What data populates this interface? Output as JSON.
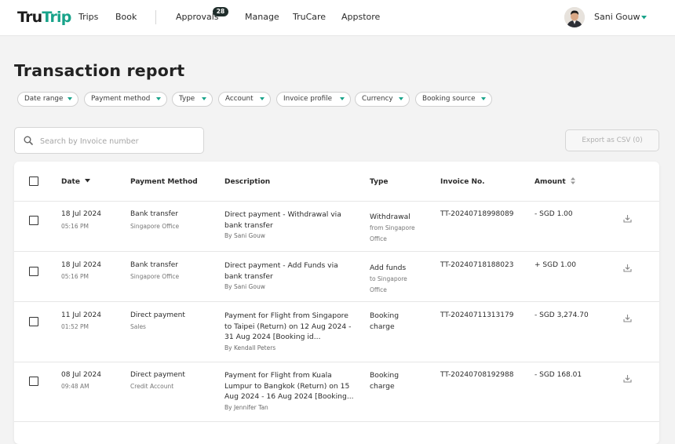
{
  "brand": {
    "part1": "Tru",
    "part2": "Trip"
  },
  "nav": {
    "trips": "Trips",
    "book": "Book",
    "approvals": "Approvals",
    "approvals_badge": "28",
    "manage": "Manage",
    "trucare": "TruCare",
    "appstore": "Appstore"
  },
  "user": {
    "name": "Sani Gouw"
  },
  "page": {
    "title": "Transaction report"
  },
  "filters": [
    "Date range",
    "Payment method",
    "Type",
    "Account",
    "Invoice profile",
    "Currency",
    "Booking source"
  ],
  "search": {
    "placeholder": "Search by Invoice number"
  },
  "export": {
    "label": "Export as CSV (0)"
  },
  "table": {
    "headers": {
      "date": "Date",
      "payment_method": "Payment Method",
      "description": "Description",
      "type": "Type",
      "invoice": "Invoice No.",
      "amount": "Amount"
    },
    "rows": [
      {
        "date": "18 Jul 2024",
        "time": "05:16 PM",
        "method": "Bank transfer",
        "account": "Singapore Office",
        "desc1": "Direct payment - Withdrawal via",
        "desc2": "bank transfer",
        "desc3": "",
        "by": "By Sani Gouw",
        "type": "Withdrawal",
        "type2": "",
        "type_sub1": "from Singapore",
        "type_sub2": "Office",
        "invoice": "TT-20240718998089",
        "amount": "- SGD 1.00"
      },
      {
        "date": "18 Jul 2024",
        "time": "05:16 PM",
        "method": "Bank transfer",
        "account": "Singapore Office",
        "desc1": "Direct payment - Add Funds via",
        "desc2": "bank transfer",
        "desc3": "",
        "by": "By Sani Gouw",
        "type": "Add funds",
        "type2": "",
        "type_sub1": "to Singapore",
        "type_sub2": "Office",
        "invoice": "TT-20240718188023",
        "amount": "+ SGD 1.00"
      },
      {
        "date": "11 Jul 2024",
        "time": "01:52 PM",
        "method": "Direct payment",
        "account": "Sales",
        "desc1": "Payment for Flight from Singapore",
        "desc2": "to Taipei (Return) on 12 Aug 2024 -",
        "desc3": "31 Aug 2024 [Booking id...",
        "by": "By Kendall Peters",
        "type": "Booking",
        "type2": "charge",
        "type_sub1": "",
        "type_sub2": "",
        "invoice": "TT-20240711313179",
        "amount": "- SGD 3,274.70"
      },
      {
        "date": "08 Jul 2024",
        "time": "09:48 AM",
        "method": "Direct payment",
        "account": "Credit Account",
        "desc1": "Payment for Flight from Kuala",
        "desc2": "Lumpur to Bangkok (Return) on 15",
        "desc3": "Aug 2024 - 16 Aug 2024 [Booking...",
        "by": "By Jennifer Tan",
        "type": "Booking",
        "type2": "charge",
        "type_sub1": "",
        "type_sub2": "",
        "invoice": "TT-20240708192988",
        "amount": "- SGD 168.01"
      }
    ]
  }
}
